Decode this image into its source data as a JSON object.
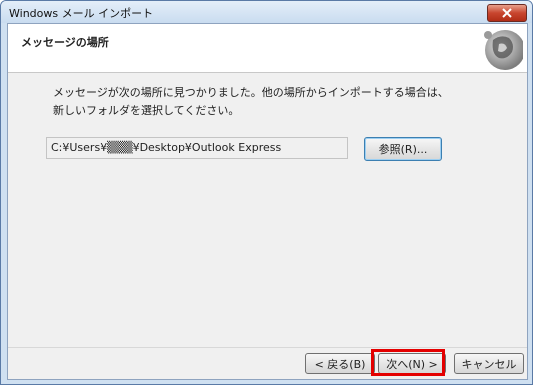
{
  "window": {
    "title": "Windows メール インポート"
  },
  "header": {
    "title": "メッセージの場所"
  },
  "body": {
    "message": "メッセージが次の場所に見つかりました。他の場所からインポートする場合は、新しいフォルダを選択してください。",
    "path_value": "C:¥Users¥▒▒▒¥Desktop¥Outlook Express"
  },
  "buttons": {
    "browse": "参照(R)...",
    "back": "< 戻る(B)",
    "next": "次へ(N) >",
    "cancel": "キャンセル"
  },
  "colors": {
    "highlight": "#e40000",
    "close_button": "#c8452e"
  }
}
